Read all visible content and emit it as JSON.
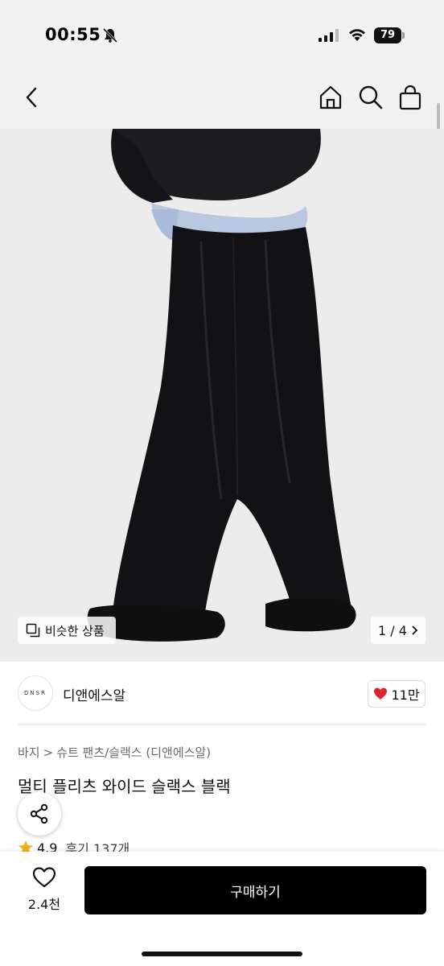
{
  "status_bar": {
    "time": "00:55",
    "battery": "79"
  },
  "product_image": {
    "counter": "1 / 4",
    "similar_label": "비슷한 상품"
  },
  "shop": {
    "logo_text": "DNSR",
    "name": "디앤에스알",
    "likes": "11만"
  },
  "breadcrumb": [
    "바지",
    "슈트 팬츠/슬랙스 (디앤에스알)"
  ],
  "product": {
    "title": "멀티 플리츠 와이드 슬랙스 블랙",
    "rating": "4.9",
    "reviews": "후기 137개"
  },
  "bottom_bar": {
    "wish_count": "2.4천",
    "buy_label": "구매하기"
  },
  "colors": {
    "like_red": "#e0242e",
    "star": "#f2b01e",
    "buy_bg": "#000000"
  }
}
